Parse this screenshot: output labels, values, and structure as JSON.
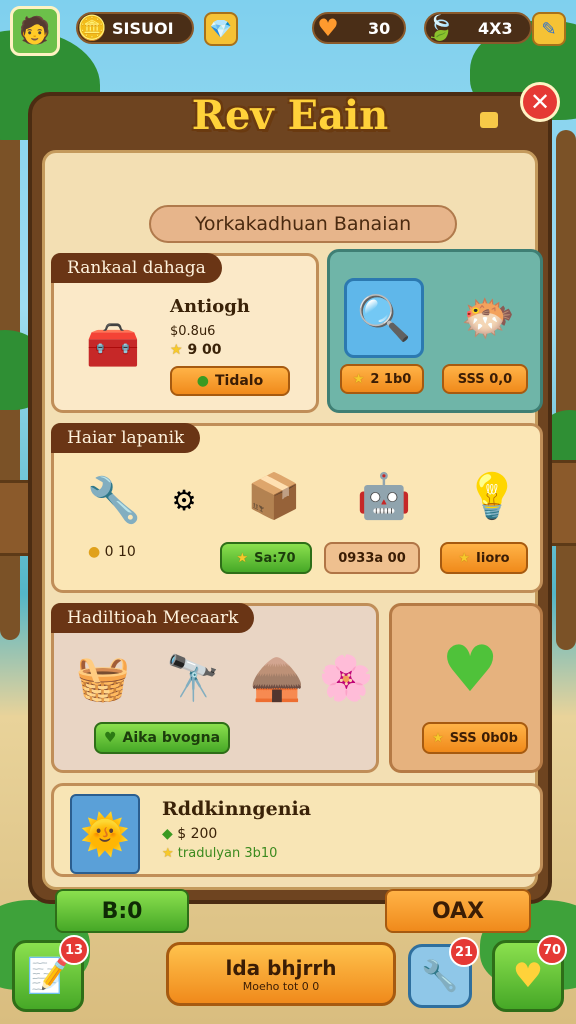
{
  "topbar": {
    "avatar_icon": "player-avatar-icon",
    "coins": {
      "icon": "gold-coin-icon",
      "value": "SISUOI"
    },
    "gems": {
      "icon": "blue-gem-icon"
    },
    "hearts": {
      "icon": "orange-heart-icon",
      "value": "30"
    },
    "leaves": {
      "icon": "green-leaf-icon",
      "value": "4X3"
    },
    "edit_icon": "pencil-icon"
  },
  "panel": {
    "title": "Rev Eain",
    "subtitle": "Yorkakadhuan Banaian",
    "close_icon": "close-icon"
  },
  "section1": {
    "tab": "Rankaal dahaga",
    "item": {
      "name": "Antiogh",
      "price": "$0.8u6",
      "stars": "9 00",
      "button": "Tidalo"
    },
    "offer_a": {
      "icon": "magnifier-badge-icon",
      "price": "2 1b0"
    },
    "offer_b": {
      "icon": "golden-creature-icon",
      "price": "SSS 0,0"
    }
  },
  "section2": {
    "tab": "Haiar lapanik",
    "item_main_coins": "0 10",
    "items": [
      {
        "icon": "wooden-crate-icon",
        "button": "Sa:70"
      },
      {
        "icon": "blue-robot-icon",
        "button": "0933a 00"
      },
      {
        "icon": "golden-lamp-icon",
        "button": "Iioro"
      }
    ]
  },
  "section3": {
    "tab": "Hadiltioah Mecaark",
    "button": "Aika bvogna",
    "offer": {
      "icon": "green-heart-icon",
      "price": "SSS 0b0b"
    }
  },
  "section4": {
    "title": "Rddkinngenia",
    "price": "$ 200",
    "subline": "tradulyan 3b10"
  },
  "actions": {
    "left": "B:0",
    "right": "OAX"
  },
  "bottombar": {
    "left": {
      "icon": "pencil-note-icon",
      "badge": "13"
    },
    "center": {
      "line1": "lda bhjrrh",
      "line2": "Moeho tot 0 0"
    },
    "tools": {
      "icon": "wrench-icon",
      "badge": "21"
    },
    "heart": {
      "icon": "heart-shop-icon",
      "badge": "70"
    }
  },
  "colors": {
    "wood_dark": "#6e4420",
    "parchment": "#f3dfb3",
    "accent_orange": "#f08a1b",
    "accent_green": "#46a827",
    "title_gold": "#ffd23a",
    "close_red": "#e53935"
  }
}
